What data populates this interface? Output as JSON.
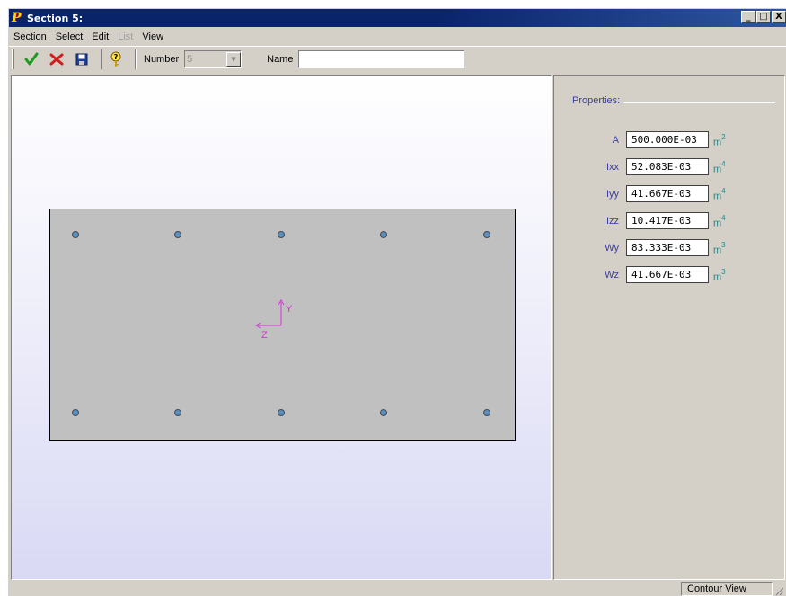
{
  "window": {
    "title": "Section 5:",
    "logo_letter": "P",
    "minimize": "_",
    "maximize": "□",
    "close": "X"
  },
  "menu": [
    {
      "label": "Section",
      "enabled": true
    },
    {
      "label": "Select",
      "enabled": true
    },
    {
      "label": "Edit",
      "enabled": true
    },
    {
      "label": "List",
      "enabled": false
    },
    {
      "label": "View",
      "enabled": true
    }
  ],
  "toolbar": {
    "accept_icon": "check-icon",
    "cancel_icon": "x-cross-icon",
    "save_icon": "floppy-disk-icon",
    "help_icon": "key-question-icon",
    "number_label": "Number",
    "number_value": "5",
    "name_label": "Name",
    "name_value": ""
  },
  "canvas": {
    "axis_y_label": "Y",
    "axis_z_label": "Z",
    "axis_color": "#d633d6",
    "section_fill": "#c0c0c0",
    "rebar_color": "#5a8fbe",
    "rebar_rows": 2,
    "rebar_per_row": 5
  },
  "properties": {
    "title": "Properties:",
    "rows": [
      {
        "label": "A",
        "value": "500.000E-03",
        "unit": "m",
        "exp": "2"
      },
      {
        "label": "Ixx",
        "value": "52.083E-03",
        "unit": "m",
        "exp": "4"
      },
      {
        "label": "Iyy",
        "value": "41.667E-03",
        "unit": "m",
        "exp": "4"
      },
      {
        "label": "Izz",
        "value": "10.417E-03",
        "unit": "m",
        "exp": "4"
      },
      {
        "label": "Wy",
        "value": "83.333E-03",
        "unit": "m",
        "exp": "3"
      },
      {
        "label": "Wz",
        "value": "41.667E-03",
        "unit": "m",
        "exp": "3"
      }
    ]
  },
  "status": {
    "view_mode": "Contour View"
  }
}
